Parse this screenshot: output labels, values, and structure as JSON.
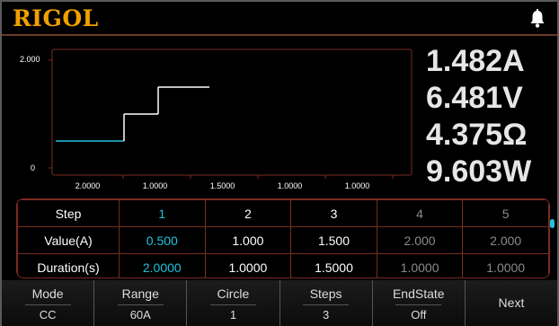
{
  "header": {
    "logo": "RIGOL",
    "alert_icon": "bell-icon"
  },
  "chart": {
    "y_tick_top": "2.000",
    "y_tick_bottom": "0",
    "x_tick_labels": [
      "2.0000",
      "1.0000",
      "1.5000",
      "1.0000",
      "1.0000"
    ],
    "active_color": "#22c3dc",
    "line_color": "#ffffff"
  },
  "chart_data": {
    "type": "line",
    "title": "",
    "xlabel": "",
    "ylabel": "",
    "ylim": [
      0,
      2.0
    ],
    "series": [
      {
        "values": [
          {
            "step": 1,
            "value": 0.5,
            "duration": 2.0
          },
          {
            "step": 2,
            "value": 1.0,
            "duration": 1.0
          },
          {
            "step": 3,
            "value": 1.5,
            "duration": 1.5
          }
        ]
      }
    ]
  },
  "readings": {
    "current": "1.482A",
    "voltage": "6.481V",
    "resistance": "4.375Ω",
    "power": "9.603W"
  },
  "table": {
    "row_headers": [
      "Step",
      "Value(A)",
      "Duration(s)"
    ],
    "steps": [
      "1",
      "2",
      "3",
      "4",
      "5"
    ],
    "values": [
      "0.500",
      "1.000",
      "1.500",
      "2.000",
      "2.000"
    ],
    "durations": [
      "2.0000",
      "1.0000",
      "1.5000",
      "1.0000",
      "1.0000"
    ],
    "active_color": "#22c3dc"
  },
  "softkeys": {
    "mode": {
      "label": "Mode",
      "value": "CC"
    },
    "range": {
      "label": "Range",
      "value": "60A"
    },
    "circle": {
      "label": "Circle",
      "value": "1"
    },
    "steps": {
      "label": "Steps",
      "value": "3"
    },
    "endstate": {
      "label": "EndState",
      "value": "Off"
    },
    "next": {
      "label": "Next"
    }
  }
}
